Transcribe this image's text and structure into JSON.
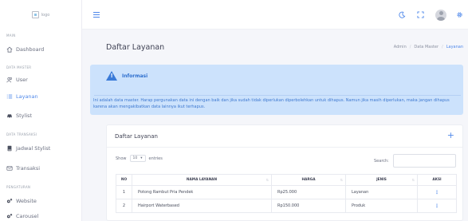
{
  "logo": {
    "alt_text": "logo"
  },
  "sidebar": {
    "sections": [
      {
        "label": "MAIN",
        "items": [
          {
            "label": "Dashboard",
            "icon": "home-icon"
          }
        ]
      },
      {
        "label": "DATA MASTER",
        "items": [
          {
            "label": "User",
            "icon": "users-icon"
          },
          {
            "label": "Layanan",
            "icon": "list-icon",
            "active": true
          },
          {
            "label": "Stylist",
            "icon": "car-icon"
          }
        ]
      },
      {
        "label": "DATA TRANSAKSI",
        "items": [
          {
            "label": "Jadwal Stylist",
            "icon": "book-icon"
          },
          {
            "label": "Transaksi",
            "icon": "mail-icon"
          }
        ]
      },
      {
        "label": "PENGATURAN",
        "items": [
          {
            "label": "Website",
            "icon": "cogs-icon"
          },
          {
            "label": "Carousel",
            "icon": "cogs-icon"
          }
        ]
      }
    ]
  },
  "topbar": {
    "icons": [
      "moon-icon",
      "fullscreen-icon",
      "avatar",
      "settings-icon"
    ]
  },
  "page": {
    "title": "Daftar Layanan",
    "breadcrumb": [
      "Admin",
      "Data Master",
      "Layanan"
    ]
  },
  "alert": {
    "title": "Informasi",
    "body": "Ini adalah data master. Harap pergunakan data ini dengan baik dan jika sudah tidak diperlukan diperbolehkan untuk dihapus. Namun jika masih diperlukan, maka jangan dihapus karena akan mengakibatkan data lainnya ikut terhapus."
  },
  "card": {
    "title": "Daftar Layanan",
    "add_symbol": "+",
    "show_label": "Show",
    "entries_value": "10",
    "entries_label": "entries",
    "search_label": "Search:",
    "columns": [
      "NO",
      "NAMA LAYANAN",
      "HARGA",
      "JENIS",
      "AKSI"
    ],
    "rows": [
      {
        "no": "1",
        "nama": "Potong Rambut Pria Pendek",
        "harga": "Rp25.000",
        "jenis": "Layanan",
        "aksi": "⋮"
      },
      {
        "no": "2",
        "nama": "Hairport Waterbased",
        "harga": "Rp150.000",
        "jenis": "Produk",
        "aksi": "⋮"
      }
    ]
  },
  "colors": {
    "accent": "#4f88ea",
    "alert_bg": "#cce2fc",
    "page_bg": "#f5f6fa"
  }
}
